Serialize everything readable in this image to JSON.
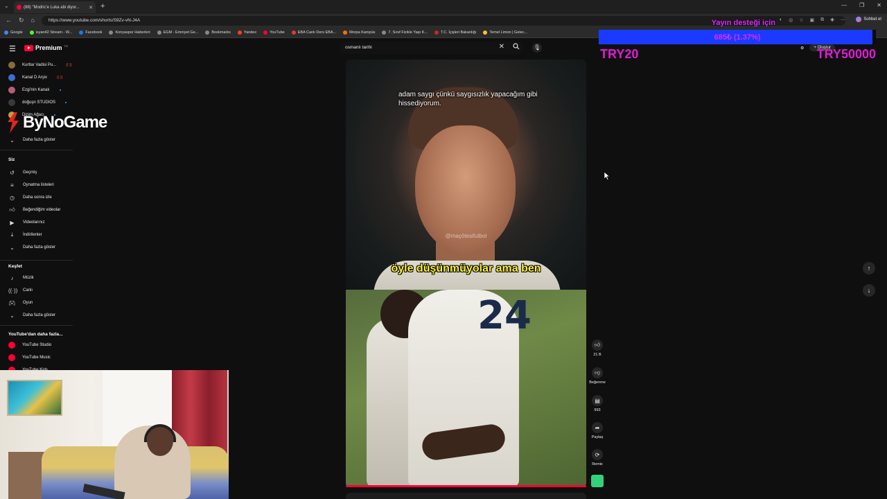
{
  "browser": {
    "tab_title": "(88) \"Modric'e Luka abi diyor...",
    "url": "https://www.youtube.com/shorts/S9Zv-vN-J4A",
    "chat_label": "Sohbet et",
    "bookmarks": [
      {
        "label": "Google",
        "color": "#4285f4"
      },
      {
        "label": "isyan42 Stream - W...",
        "color": "#53fc18"
      },
      {
        "label": "Facebook",
        "color": "#1877f2"
      },
      {
        "label": "Konyaspor Haberleri",
        "color": "#888888"
      },
      {
        "label": "EGM - Emniyet Ge...",
        "color": "#888888"
      },
      {
        "label": "Bookmarks",
        "color": "#888888"
      },
      {
        "label": "Yandex",
        "color": "#fc3f1d"
      },
      {
        "label": "YouTube",
        "color": "#ff0033"
      },
      {
        "label": "EBA Canlı Ders EBA...",
        "color": "#e53935"
      },
      {
        "label": "Morpa Kampüs",
        "color": "#ff6f00"
      },
      {
        "label": "7. Sınıf Fizikle Yapı K...",
        "color": "#888888"
      },
      {
        "label": "T.C. İçişleri Bakanlığı",
        "color": "#c62828"
      },
      {
        "label": "Temel Limon | Gelec...",
        "color": "#fbc02d"
      }
    ]
  },
  "youtube": {
    "logo_text": "Premium",
    "logo_sup": "TR",
    "search_value": "osmanlı tarihi",
    "create_label": "Oluştur",
    "subscriptions": [
      {
        "label": "Kurtlar Vadisi Pu...",
        "badge": "live"
      },
      {
        "label": "Kanal D Arşiv",
        "badge": "live"
      },
      {
        "label": "Ezgi'nin Kanalı",
        "badge": "dot"
      },
      {
        "label": "doğuşn STUDIOS",
        "badge": "dot"
      },
      {
        "label": "Dizim Ağacı",
        "badge": "dot"
      }
    ],
    "show_more": "Daha fazla göster",
    "you_heading": "Siz",
    "you_items": [
      {
        "label": "Geçmiş",
        "icon": "history-icon"
      },
      {
        "label": "Oynatma listeleri",
        "icon": "playlist-icon"
      },
      {
        "label": "Daha sonra izle",
        "icon": "clock-icon"
      },
      {
        "label": "Beğendiğim videolar",
        "icon": "thumbs-up-icon"
      },
      {
        "label": "Videolarınız",
        "icon": "video-icon"
      },
      {
        "label": "İndirilenler",
        "icon": "download-icon"
      },
      {
        "label": "Daha fazla göster",
        "icon": "chevron-down-icon"
      }
    ],
    "explore_heading": "Keşfet",
    "explore_items": [
      {
        "label": "Müzik",
        "icon": "music-icon"
      },
      {
        "label": "Canlı",
        "icon": "live-icon"
      },
      {
        "label": "Oyun",
        "icon": "gamepad-icon"
      },
      {
        "label": "Daha fazla göster",
        "icon": "chevron-down-icon"
      }
    ],
    "more_heading": "YouTube'dan daha fazla...",
    "more_items": [
      {
        "label": "YouTube Studio"
      },
      {
        "label": "YouTube Music"
      },
      {
        "label": "YouTube Kids"
      }
    ],
    "short": {
      "subtitle_top": "adam saygı çünkü saygısızlık yapacağım gibi hissediyorum.",
      "subtitle_mid": "öyle düşünmüyolar ama ben",
      "watermark": "@maçötesifutbol",
      "jersey_number": "24",
      "progress": 1.0
    },
    "actions": {
      "like_count": "21 B",
      "dislike_label": "Beğenme",
      "comment_count": "993",
      "share_label": "Paylaş",
      "remix_label": "Remix"
    }
  },
  "overlay": {
    "brand": "ByNoGame",
    "donation_title": "Yayın desteği için",
    "donation_amount": "685₺ (1.37%)",
    "donation_fraction": 0.0137,
    "try_left": "TRY20",
    "try_right": "TRY50000",
    "accent_color": "#e11bd8"
  }
}
